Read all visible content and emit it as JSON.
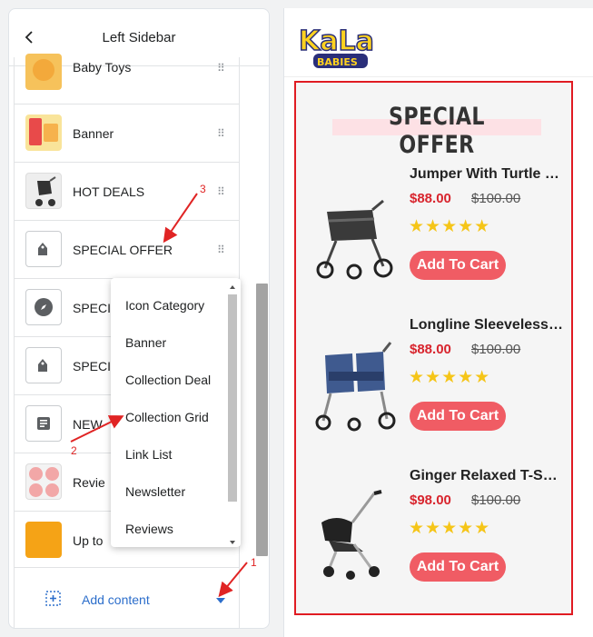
{
  "editor": {
    "title": "Left Sidebar",
    "sections": [
      {
        "label": "Baby Toys",
        "icon": "baby-toys-thumb"
      },
      {
        "label": "Banner",
        "icon": "banner-thumb"
      },
      {
        "label": "HOT DEALS",
        "icon": "stroller-thumb"
      },
      {
        "label": "SPECIAL OFFER",
        "icon": "tag-icon"
      },
      {
        "label": "SPECI",
        "icon": "compass-icon"
      },
      {
        "label": "SPECI",
        "icon": "tag-icon"
      },
      {
        "label": "NEW",
        "icon": "text-icon"
      },
      {
        "label": "Revie",
        "icon": "reviews-thumb"
      },
      {
        "label": "Up to",
        "icon": "promo-thumb"
      }
    ],
    "add_content_label": "Add content"
  },
  "dropdown": {
    "items": [
      "Icon Category",
      "Banner",
      "Collection Deal",
      "Collection Grid",
      "Link List",
      "Newsletter",
      "Reviews"
    ]
  },
  "annotations": [
    "1",
    "2",
    "3"
  ],
  "preview": {
    "logo_top": "KaLa",
    "logo_bottom": "BABIES",
    "offer_title": "SPECIAL OFFER",
    "products": [
      {
        "name": "Jumper With Turtle Neck",
        "price": "$88.00",
        "old_price": "$100.00",
        "rating": 5,
        "button": "Add To Cart"
      },
      {
        "name": "Longline Sleeveless T-s...",
        "price": "$88.00",
        "old_price": "$100.00",
        "rating": 5,
        "button": "Add To Cart"
      },
      {
        "name": "Ginger Relaxed T-ShIRT",
        "price": "$98.00",
        "old_price": "$100.00",
        "rating": 5,
        "button": "Add To Cart"
      }
    ]
  },
  "colors": {
    "frame_red": "#e01b22",
    "price_red": "#d8242d",
    "button_pink": "#f05c64",
    "star_yellow": "#f5c518",
    "link_blue": "#2c6ecb"
  }
}
